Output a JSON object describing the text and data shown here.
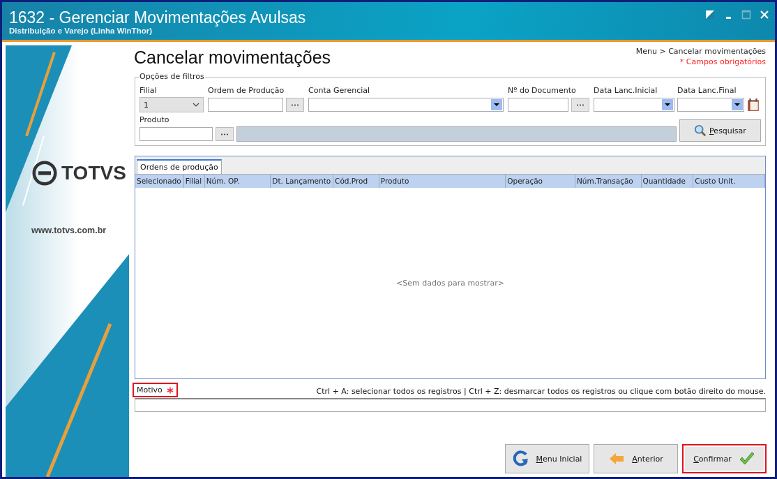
{
  "window": {
    "title": "1632 - Gerenciar Movimentações Avulsas",
    "subtitle": "Distribuição e Varejo (Linha WinThor)"
  },
  "sidebar": {
    "logo": "TOTVS",
    "website": "www.totvs.com.br"
  },
  "page": {
    "title": "Cancelar movimentações",
    "breadcrumb": "Menu > Cancelar movimentações",
    "required_note": "* Campos obrigatórios"
  },
  "filters": {
    "legend": "Opções de filtros",
    "row_1": [
      {
        "label": "Filial",
        "kind": "select",
        "value": "1"
      },
      {
        "label": "Ordem de Produção",
        "kind": "lookup"
      },
      {
        "label": "Conta Gerencial",
        "kind": "dropdown"
      },
      {
        "label": "Nº do Documento",
        "kind": "lookup"
      },
      {
        "label": "Data Lanc.Inicial",
        "kind": "dropdown"
      },
      {
        "label": "Data Lanc.Final",
        "kind": "date"
      }
    ],
    "row_2": [
      {
        "label": "Produto",
        "kind": "lookup-description"
      }
    ],
    "search_button": "Pesquisar"
  },
  "grid": {
    "tabs": [
      {
        "label": "Ordens de produção",
        "selected": true
      }
    ],
    "columns": [
      "Selecionado",
      "Filial",
      "Núm. OP.",
      "Dt. Lançamento",
      "Cód.Prod",
      "Produto",
      "Operação",
      "Núm.Transação",
      "Quantidade",
      "Custo Unit."
    ],
    "empty_text": "<Sem dados para mostrar>"
  },
  "hint": "Ctrl + A: selecionar todos os registros | Ctrl + Z: desmarcar todos os registros ou clique com botão direito do mouse.",
  "motivo": {
    "label": "Motivo",
    "required": true,
    "highlighted": true
  },
  "buttons": [
    {
      "label": "Menu Inicial",
      "kind": "home",
      "highlighted": false
    },
    {
      "label": "Anterior",
      "kind": "back",
      "highlighted": false
    },
    {
      "label": "Confirmar",
      "kind": "confirm",
      "highlighted": true
    }
  ]
}
